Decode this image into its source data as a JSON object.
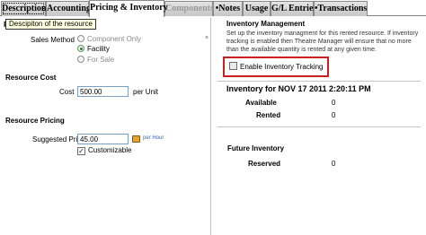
{
  "tabs": [
    {
      "label": "Description",
      "state": "outlined"
    },
    {
      "label": "Accounting",
      "state": "normal"
    },
    {
      "label": "Pricing & Inventory",
      "state": "active"
    },
    {
      "label": "Components",
      "state": "disabled"
    },
    {
      "label": "•Notes",
      "state": "normal"
    },
    {
      "label": "Usage",
      "state": "normal"
    },
    {
      "label": "G/L Entries",
      "state": "normal"
    },
    {
      "label": "•Transactions",
      "state": "normal"
    }
  ],
  "tooltip": "Descipiton of the resource",
  "left": {
    "sales_method_label": "Sales Method",
    "sales_options": [
      {
        "label": "Component Only",
        "selected": false,
        "enabled": false
      },
      {
        "label": "Facility",
        "selected": true,
        "enabled": true
      },
      {
        "label": "For Sale",
        "selected": false,
        "enabled": false
      }
    ],
    "resource_cost_title": "Resource Cost",
    "cost_label": "Cost",
    "cost_value": "500.00",
    "cost_unit": "per Unit",
    "resource_pricing_title": "Resource Pricing",
    "suggested_price_label": "Suggested Price",
    "suggested_price_value": "45.00",
    "per_hour_label": "per Hour",
    "customizable_label": "Customizable",
    "customizable_checked": true
  },
  "right": {
    "inventory_management_title": "Inventory Management",
    "info_text": "Set up the inventory managment for this rented resource.  If inventory tracking is enabled then Theatre Manager will ensure that no more than the available quantity is rented at any given time.",
    "enable_tracking_label": "Enable Inventory Tracking",
    "enable_tracking_checked": false,
    "inventory_for_title": "Inventory for NOV 17 2011 2:20:11 PM",
    "available_label": "Available",
    "available_value": "0",
    "rented_label": "Rented",
    "rented_value": "0",
    "future_inventory_title": "Future Inventory",
    "reserved_label": "Reserved",
    "reserved_value": "0"
  }
}
